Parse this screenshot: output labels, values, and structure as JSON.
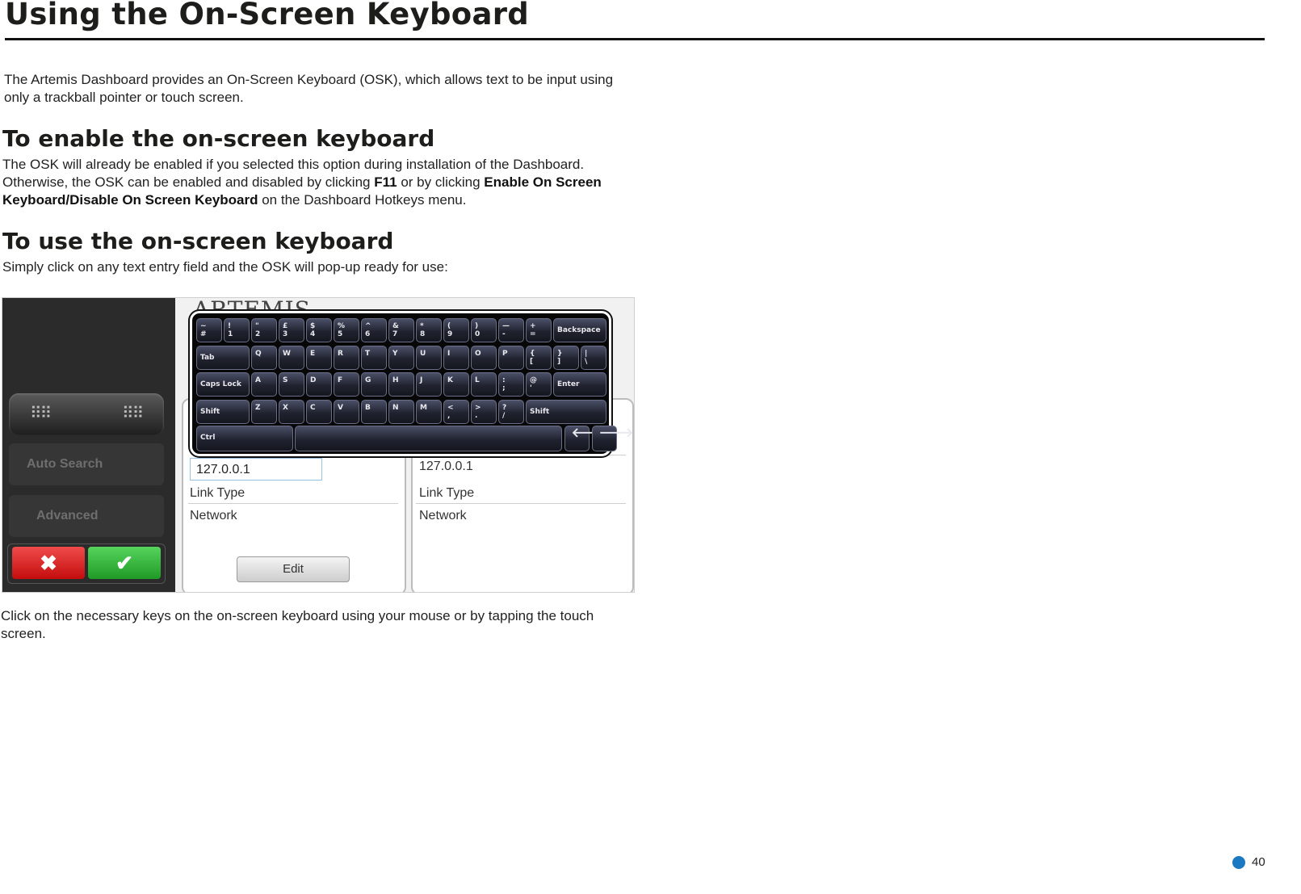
{
  "title": "Using the On-Screen Keyboard",
  "intro": "The Artemis Dashboard provides an On-Screen Keyboard (OSK), which allows text to be input using only a trackball pointer or touch screen.",
  "section1": {
    "heading": "To enable the on-screen keyboard",
    "text_a": "The OSK will already be enabled if you selected this option during installation of the Dashboard. Otherwise, the OSK can be enabled and disabled by clicking ",
    "bold_a": "F11",
    "text_b": " or by clicking ",
    "bold_b": "Enable On Screen Keyboard/Disable On Screen Keyboard",
    "text_c": " on the Dashboard Hotkeys menu."
  },
  "section2": {
    "heading": "To use the on-screen keyboard",
    "text": "Simply click on any text entry field and the OSK will pop-up ready for use:",
    "after": "Click on the necessary keys on the on-screen keyboard using your mouse or by tapping the touch screen."
  },
  "figure": {
    "brand": "ARTEMIS",
    "auto_search": "Auto Search",
    "advanced": "Advanced",
    "cancel_glyph": "✖",
    "confirm_glyph": "✔",
    "ip_left": "127.0.0.1",
    "ip_right": "127.0.0.1",
    "link_type": "Link Type",
    "network": "Network",
    "edit": "Edit",
    "keyboard_rows": [
      [
        "~\n#",
        "!\n1",
        "\"\n2",
        "£\n3",
        "$\n4",
        "%\n5",
        "^\n6",
        "&\n7",
        "*\n8",
        "(\n9",
        ")\n0",
        "—\n-",
        "+\n=",
        "Backspace"
      ],
      [
        "Tab",
        "Q",
        "W",
        "E",
        "R",
        "T",
        "Y",
        "U",
        "I",
        "O",
        "P",
        "{\n[",
        "}\n]",
        "|\n\\"
      ],
      [
        "Caps Lock",
        "A",
        "S",
        "D",
        "F",
        "G",
        "H",
        "J",
        "K",
        "L",
        ":\n;",
        "@\n'",
        "Enter"
      ],
      [
        "Shift",
        "Z",
        "X",
        "C",
        "V",
        "B",
        "N",
        "M",
        "<\n,",
        ">\n.",
        "?\n/",
        "Shift"
      ],
      [
        "Ctrl",
        "",
        "🡐",
        "🡒"
      ]
    ]
  },
  "page_number": "40",
  "colors": {
    "page_dot": "#1b79c1"
  }
}
